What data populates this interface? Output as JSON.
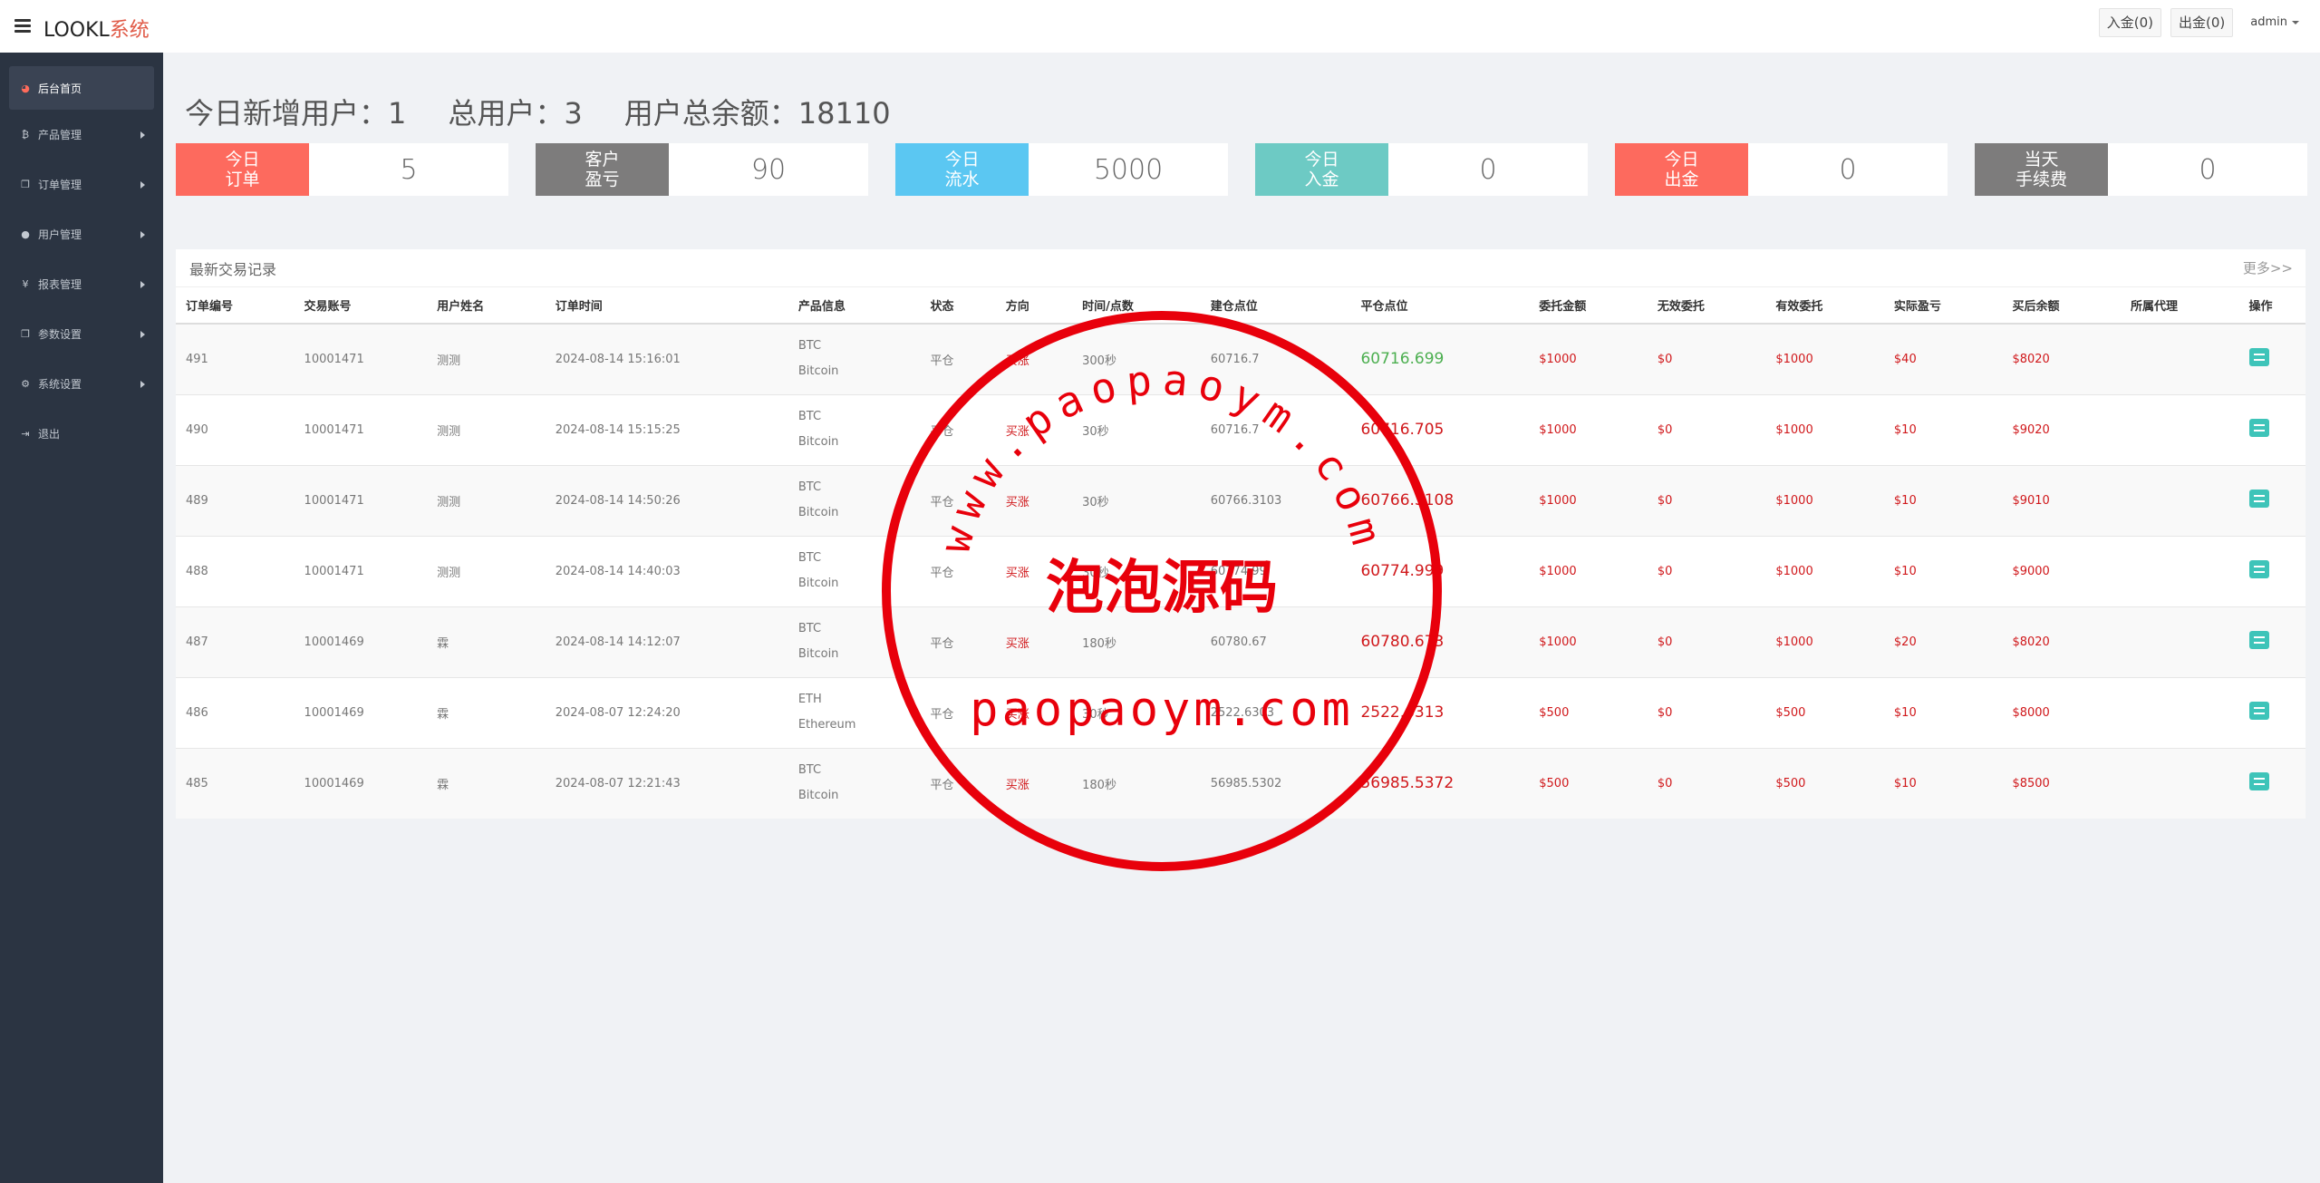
{
  "header": {
    "brand_main": "LOOKL",
    "brand_accent": "系统",
    "deposit": "入金(0)",
    "withdraw": "出金(0)",
    "user": "admin"
  },
  "sidebar": {
    "items": [
      {
        "label": "后台首页",
        "icon": "dashboard-icon"
      },
      {
        "label": "产品管理",
        "icon": "bitcoin-icon"
      },
      {
        "label": "订单管理",
        "icon": "copy-icon"
      },
      {
        "label": "用户管理",
        "icon": "user-icon"
      },
      {
        "label": "报表管理",
        "icon": "yen-icon"
      },
      {
        "label": "参数设置",
        "icon": "copy-icon"
      },
      {
        "label": "系统设置",
        "icon": "gears-icon"
      },
      {
        "label": "退出",
        "icon": "sign-out-icon"
      }
    ]
  },
  "summary": {
    "new_users": "今日新增用户：1",
    "total_users": "总用户：3",
    "total_balance": "用户总余额：18110"
  },
  "cards": [
    {
      "label1": "今日",
      "label2": "订单",
      "value": "5",
      "color": "#fd6a5e"
    },
    {
      "label1": "客户",
      "label2": "盈亏",
      "value": "90",
      "color": "#7d7c7c"
    },
    {
      "label1": "今日",
      "label2": "流水",
      "value": "5000",
      "color": "#5bc7f2"
    },
    {
      "label1": "今日",
      "label2": "入金",
      "value": "0",
      "color": "#6dcac4"
    },
    {
      "label1": "今日",
      "label2": "出金",
      "value": "0",
      "color": "#fd6a5e"
    },
    {
      "label1": "当天",
      "label2": "手续费",
      "value": "0",
      "color": "#7d7c7c"
    }
  ],
  "panel": {
    "title": "最新交易记录",
    "more": "更多>>",
    "columns": [
      "订单编号",
      "交易账号",
      "用户姓名",
      "订单时间",
      "产品信息",
      "状态",
      "方向",
      "时间/点数",
      "建仓点位",
      "平仓点位",
      "委托金额",
      "无效委托",
      "有效委托",
      "实际盈亏",
      "买后余额",
      "所属代理",
      "操作"
    ],
    "rows": [
      {
        "id": "491",
        "account": "10001471",
        "name": "测测",
        "time": "2024-08-14 15:16:01",
        "sym": "BTC",
        "prod": "Bitcoin",
        "status": "平仓",
        "dir": "买涨",
        "dur": "300秒",
        "open": "60716.7",
        "close": "60716.699",
        "amount": "$1000",
        "invalid": "$0",
        "valid": "$1000",
        "pnl": "$40",
        "balance": "$8020",
        "agent": "",
        "close_color": "green"
      },
      {
        "id": "490",
        "account": "10001471",
        "name": "测测",
        "time": "2024-08-14 15:15:25",
        "sym": "BTC",
        "prod": "Bitcoin",
        "status": "平仓",
        "dir": "买涨",
        "dur": "30秒",
        "open": "60716.7",
        "close": "60716.705",
        "amount": "$1000",
        "invalid": "$0",
        "valid": "$1000",
        "pnl": "$10",
        "balance": "$9020",
        "agent": "",
        "close_color": "red"
      },
      {
        "id": "489",
        "account": "10001471",
        "name": "测测",
        "time": "2024-08-14 14:50:26",
        "sym": "BTC",
        "prod": "Bitcoin",
        "status": "平仓",
        "dir": "买涨",
        "dur": "30秒",
        "open": "60766.3103",
        "close": "60766.3108",
        "amount": "$1000",
        "invalid": "$0",
        "valid": "$1000",
        "pnl": "$10",
        "balance": "$9010",
        "agent": "",
        "close_color": "red"
      },
      {
        "id": "488",
        "account": "10001471",
        "name": "测测",
        "time": "2024-08-14 14:40:03",
        "sym": "BTC",
        "prod": "Bitcoin",
        "status": "平仓",
        "dir": "买涨",
        "dur": "30秒",
        "open": "60774.99",
        "close": "60774.999",
        "amount": "$1000",
        "invalid": "$0",
        "valid": "$1000",
        "pnl": "$10",
        "balance": "$9000",
        "agent": "",
        "close_color": "red"
      },
      {
        "id": "487",
        "account": "10001469",
        "name": "霖",
        "time": "2024-08-14 14:12:07",
        "sym": "BTC",
        "prod": "Bitcoin",
        "status": "平仓",
        "dir": "买涨",
        "dur": "180秒",
        "open": "60780.67",
        "close": "60780.673",
        "amount": "$1000",
        "invalid": "$0",
        "valid": "$1000",
        "pnl": "$20",
        "balance": "$8020",
        "agent": "",
        "close_color": "red"
      },
      {
        "id": "486",
        "account": "10001469",
        "name": "霖",
        "time": "2024-08-07 12:24:20",
        "sym": "ETH",
        "prod": "Ethereum",
        "status": "平仓",
        "dir": "买涨",
        "dur": "30秒",
        "open": "2522.6303",
        "close": "2522.6313",
        "amount": "$500",
        "invalid": "$0",
        "valid": "$500",
        "pnl": "$10",
        "balance": "$8000",
        "agent": "",
        "close_color": "red"
      },
      {
        "id": "485",
        "account": "10001469",
        "name": "霖",
        "time": "2024-08-07 12:21:43",
        "sym": "BTC",
        "prod": "Bitcoin",
        "status": "平仓",
        "dir": "买涨",
        "dur": "180秒",
        "open": "56985.5302",
        "close": "56985.5372",
        "amount": "$500",
        "invalid": "$0",
        "valid": "$500",
        "pnl": "$10",
        "balance": "$8500",
        "agent": "",
        "close_color": "red"
      }
    ]
  },
  "watermark": {
    "arc_text": "www.paopaoym.com",
    "center_text": "泡泡源码",
    "bottom_text": "paopaoym.com",
    "color": "#e8000b"
  }
}
